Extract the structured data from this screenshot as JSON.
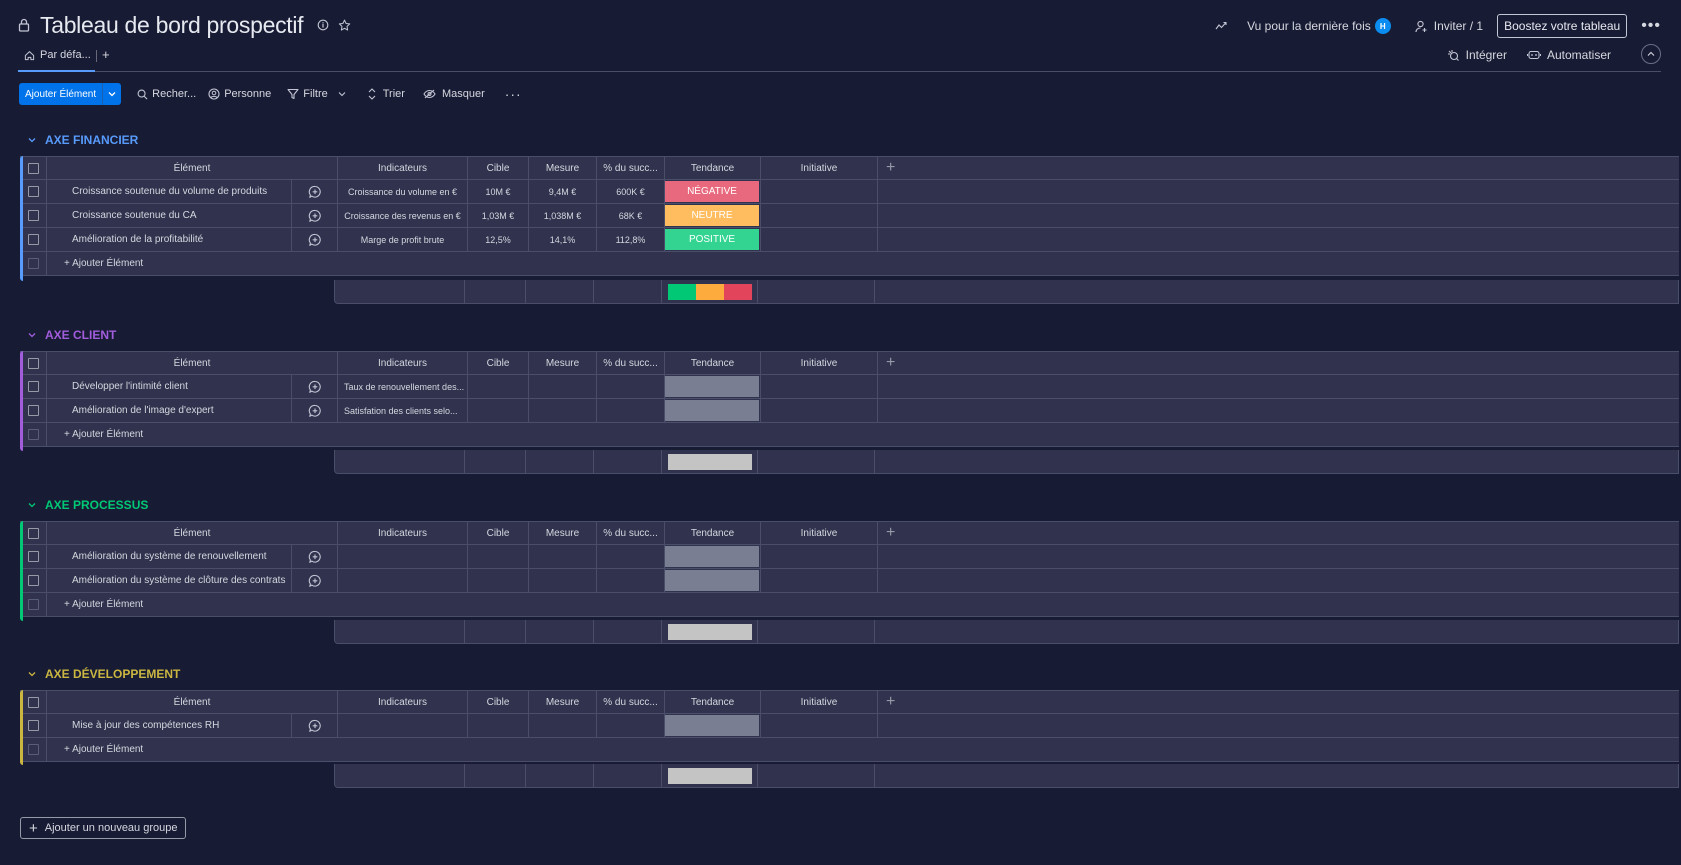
{
  "header": {
    "title": "Tableau de bord prospectif",
    "last_seen_label": "Vu pour la dernière fois",
    "avatar_initial": "H",
    "invite_label": "Inviter / 1",
    "boost_label": "Boostez votre tableau",
    "more_label": "•••"
  },
  "views": {
    "tabs": [
      {
        "label": "Par défa..."
      }
    ],
    "add_label": "+",
    "integrate_label": "Intégrer",
    "automate_label": "Automatiser",
    "collapse_label": "^"
  },
  "toolbar": {
    "add_item_label": "Ajouter Élément",
    "search_label": "Recher...",
    "person_label": "Personne",
    "filter_label": "Filtre",
    "sort_label": "Trier",
    "hide_label": "Masquer",
    "more_label": "···"
  },
  "columns": {
    "element": "Élément",
    "indicateurs": "Indicateurs",
    "cible": "Cible",
    "mesure": "Mesure",
    "succes": "% du succ...",
    "tendance": "Tendance",
    "initiative": "Initiative",
    "add": "+"
  },
  "status_colors": {
    "negative": "#e2445c",
    "neutral": "#fdab3d",
    "positive": "#00c875",
    "empty": "#797e93",
    "summary_empty": "#c4c4c4"
  },
  "add_item_row_label": "+ Ajouter Élément",
  "groups": [
    {
      "title": "AXE FINANCIER",
      "color": "#579bfc",
      "rows": [
        {
          "name": "Croissance soutenue du volume de produits",
          "indicateur": "Croissance du volume en €",
          "cible": "10M €",
          "mesure": "9,4M €",
          "succes": "600K €",
          "tendance": "NÉGATIVE",
          "tendance_color": "#e8697d"
        },
        {
          "name": "Croissance soutenue du CA",
          "indicateur": "Croissance des revenus en €",
          "cible": "1,03M €",
          "mesure": "1,038M €",
          "succes": "68K €",
          "tendance": "NEUTRE",
          "tendance_color": "#ffbd5f"
        },
        {
          "name": "Amélioration de la profitabilité",
          "indicateur": "Marge de profit brute",
          "cible": "12,5%",
          "mesure": "14,1%",
          "succes": "112,8%",
          "tendance": "POSITIVE",
          "tendance_color": "#33d391"
        }
      ],
      "summary": [
        {
          "label": "POSITIVE",
          "fraction": 0.3333,
          "color": "#00c875"
        },
        {
          "label": "NEUTRE",
          "fraction": 0.3333,
          "color": "#fdab3d"
        },
        {
          "label": "NÉGATIVE",
          "fraction": 0.3334,
          "color": "#e2445c"
        }
      ]
    },
    {
      "title": "AXE CLIENT",
      "color": "#a25ddc",
      "rows": [
        {
          "name": "Développer l'intimité client",
          "indicateur": "Taux de renouvellement des...",
          "cible": "",
          "mesure": "",
          "succes": "",
          "tendance": "",
          "tendance_color": "#797e93"
        },
        {
          "name": "Amélioration de l'image d'expert",
          "indicateur": "Satisfation des clients selo...",
          "cible": "",
          "mesure": "",
          "succes": "",
          "tendance": "",
          "tendance_color": "#797e93"
        }
      ],
      "summary": [
        {
          "label": "",
          "fraction": 1,
          "color": "#c4c4c4"
        }
      ]
    },
    {
      "title": "AXE PROCESSUS",
      "color": "#00c875",
      "rows": [
        {
          "name": "Amélioration du système de renouvellement",
          "indicateur": "",
          "cible": "",
          "mesure": "",
          "succes": "",
          "tendance": "",
          "tendance_color": "#797e93"
        },
        {
          "name": "Amélioration du système de clôture des contrats",
          "indicateur": "",
          "cible": "",
          "mesure": "",
          "succes": "",
          "tendance": "",
          "tendance_color": "#797e93"
        }
      ],
      "summary": [
        {
          "label": "",
          "fraction": 1,
          "color": "#c4c4c4"
        }
      ]
    },
    {
      "title": "AXE DÉVELOPPEMENT",
      "color": "#cab641",
      "rows": [
        {
          "name": "Mise à jour des compétences RH",
          "indicateur": "",
          "cible": "",
          "mesure": "",
          "succes": "",
          "tendance": "",
          "tendance_color": "#797e93"
        }
      ],
      "summary": [
        {
          "label": "",
          "fraction": 1,
          "color": "#c4c4c4"
        }
      ]
    }
  ],
  "new_group_label": "Ajouter un nouveau groupe"
}
